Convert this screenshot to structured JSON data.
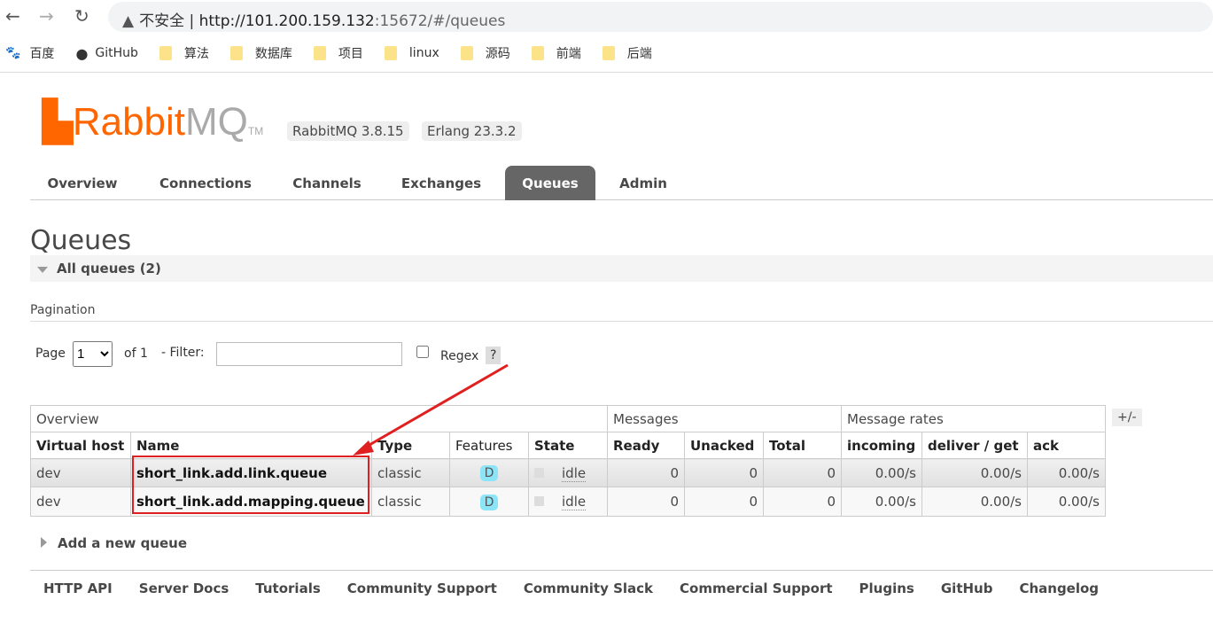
{
  "browser": {
    "url_warning": "不安全",
    "url_host": "http://101.200.159.132",
    "url_rest": ":15672/#/queues"
  },
  "bookmarks": [
    "百度",
    "GitHub",
    "算法",
    "数据库",
    "项目",
    "linux",
    "源码",
    "前端",
    "后端"
  ],
  "header": {
    "logo_rabbit": "Rabbit",
    "logo_mq": "MQ",
    "logo_tm": "TM",
    "version": "RabbitMQ 3.8.15",
    "erlang": "Erlang 23.3.2"
  },
  "tabs": [
    "Overview",
    "Connections",
    "Channels",
    "Exchanges",
    "Queues",
    "Admin"
  ],
  "active_tab": "Queues",
  "page_title": "Queues",
  "all_queues": "All queues (2)",
  "pagination": {
    "label": "Pagination",
    "page_label": "Page",
    "page_value": "1",
    "of": "of 1",
    "filter_label": "- Filter:",
    "filter_value": "",
    "regex": "Regex",
    "help": "?"
  },
  "table": {
    "groups": [
      "Overview",
      "Messages",
      "Message rates"
    ],
    "columns": [
      "Virtual host",
      "Name",
      "Type",
      "Features",
      "State",
      "Ready",
      "Unacked",
      "Total",
      "incoming",
      "deliver / get",
      "ack"
    ],
    "rows": [
      [
        "dev",
        "short_link.add.link.queue",
        "classic",
        "D",
        "idle",
        "0",
        "0",
        "0",
        "0.00/s",
        "0.00/s",
        "0.00/s"
      ],
      [
        "dev",
        "short_link.add.mapping.queue",
        "classic",
        "D",
        "idle",
        "0",
        "0",
        "0",
        "0.00/s",
        "0.00/s",
        "0.00/s"
      ]
    ],
    "toggle": "+/-"
  },
  "add_queue": "Add a new queue",
  "footer": [
    "HTTP API",
    "Server Docs",
    "Tutorials",
    "Community Support",
    "Community Slack",
    "Commercial Support",
    "Plugins",
    "GitHub",
    "Changelog"
  ],
  "colors": {
    "accent": "#ff6600",
    "annotation": "#e02020",
    "badge": "#8ce4f7"
  }
}
